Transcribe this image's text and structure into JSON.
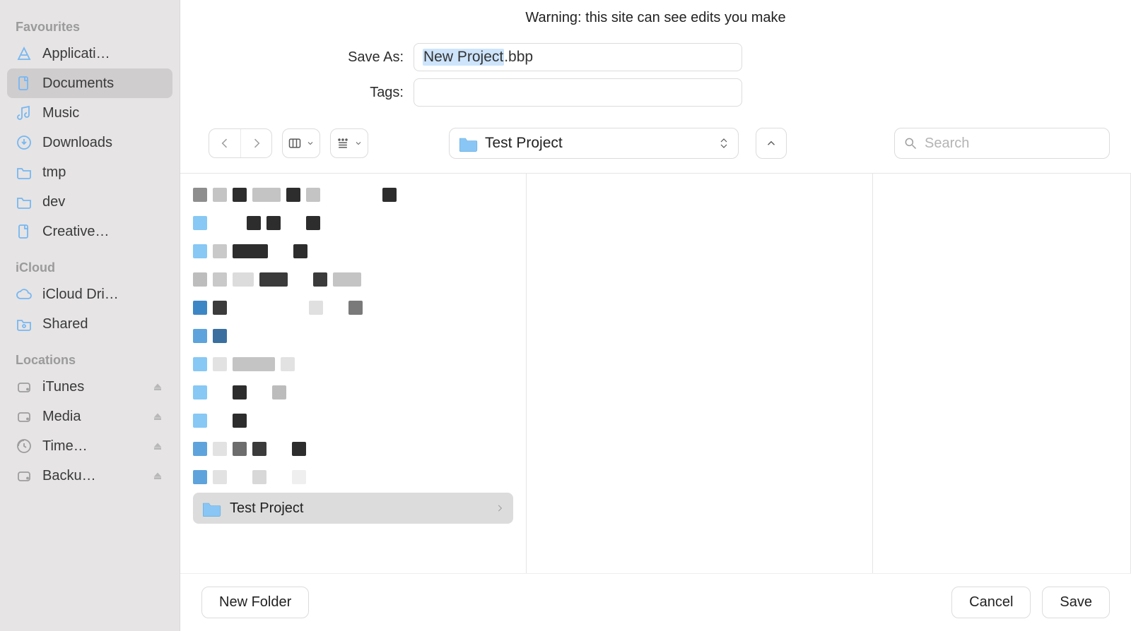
{
  "warning": "Warning: this site can see edits you make",
  "form": {
    "save_as_label": "Save As:",
    "tags_label": "Tags:",
    "filename_base": "New Project",
    "filename_ext": ".bbp",
    "tags_value": ""
  },
  "toolbar": {
    "current_folder": "Test Project",
    "search_placeholder": "Search"
  },
  "sidebar": {
    "sections": {
      "favourites": {
        "header": "Favourites",
        "items": [
          {
            "label": "Applicati…",
            "icon": "apps"
          },
          {
            "label": "Documents",
            "icon": "doc",
            "selected": true
          },
          {
            "label": "Music",
            "icon": "music"
          },
          {
            "label": "Downloads",
            "icon": "download"
          },
          {
            "label": "tmp",
            "icon": "folder"
          },
          {
            "label": "dev",
            "icon": "folder"
          },
          {
            "label": "Creative…",
            "icon": "doc"
          }
        ]
      },
      "icloud": {
        "header": "iCloud",
        "items": [
          {
            "label": "iCloud Dri…",
            "icon": "cloud"
          },
          {
            "label": "Shared",
            "icon": "sharedfolder"
          }
        ]
      },
      "locations": {
        "header": "Locations",
        "items": [
          {
            "label": "iTunes",
            "icon": "disk",
            "eject": true
          },
          {
            "label": "Media",
            "icon": "disk",
            "eject": true
          },
          {
            "label": "Time…",
            "icon": "time",
            "eject": true
          },
          {
            "label": "Backu…",
            "icon": "disk",
            "eject": true
          }
        ]
      }
    }
  },
  "browser": {
    "selected_folder": "Test Project"
  },
  "footer": {
    "new_folder": "New Folder",
    "cancel": "Cancel",
    "save": "Save"
  }
}
